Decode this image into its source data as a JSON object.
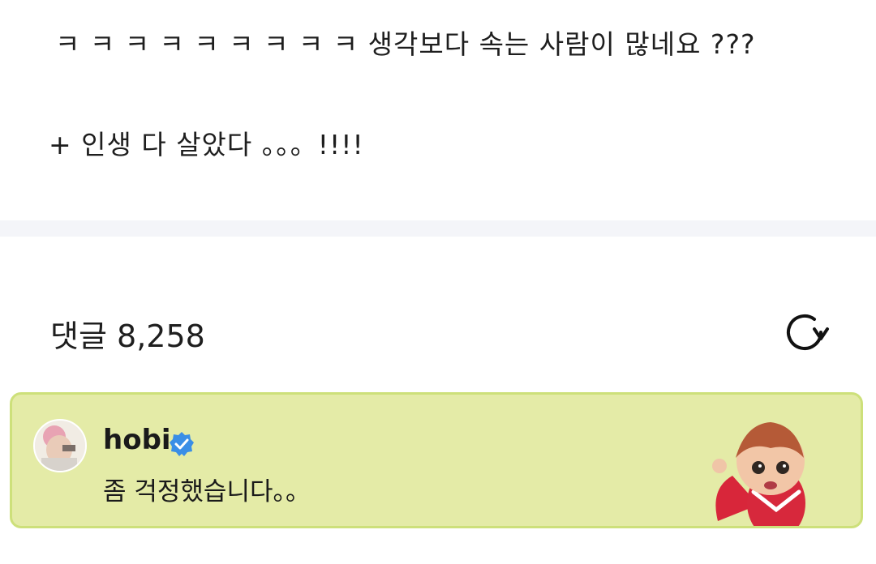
{
  "post": {
    "line1": "ㅋ ㅋ ㅋ ㅋ ㅋ ㅋ ㅋ ㅋ ㅋ 생각보다 속는 사람이 많네요 ???",
    "line2": "+ 인생 다 살았다 。。。!!!!"
  },
  "comments": {
    "label": "댓글",
    "count": "8,258",
    "refresh_icon": "refresh-icon"
  },
  "pinned_comment": {
    "author": "hobi",
    "verified": true,
    "text": "좀 걱정했습니다。。",
    "avatar_icon": "user-avatar",
    "sticker_icon": "character-sticker",
    "background": "#e4eba7",
    "border": "#cde07a",
    "verified_color": "#3a8ee6"
  }
}
